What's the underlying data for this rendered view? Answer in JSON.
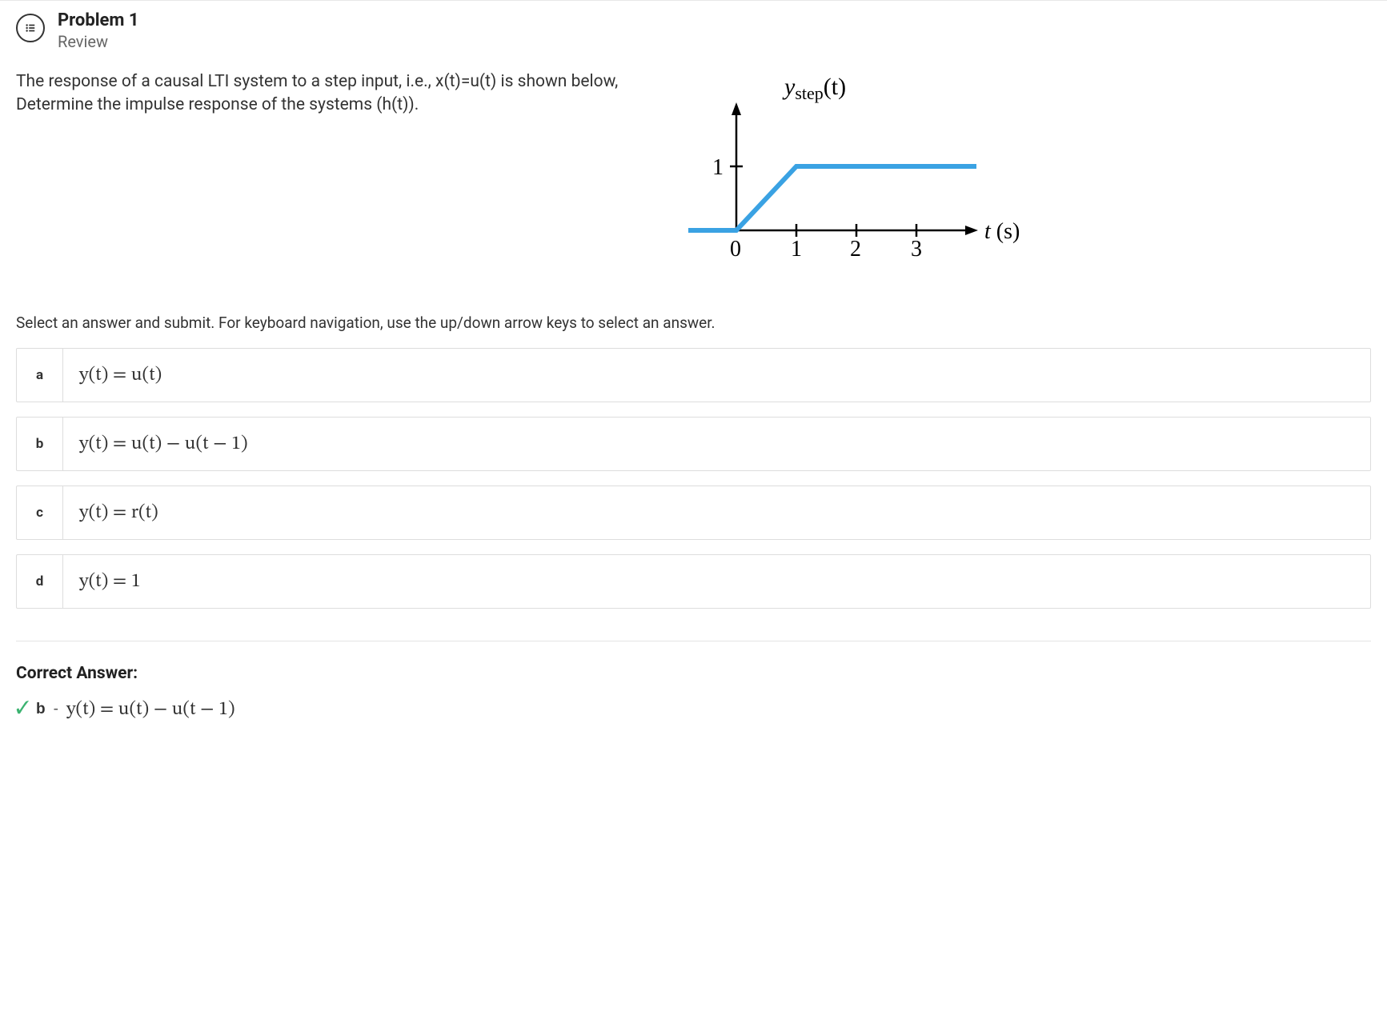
{
  "header": {
    "title": "Problem 1",
    "subtitle": "Review"
  },
  "question": {
    "line1": "The response of a causal LTI system to a step input, i.e., x(t)=u(t) is shown below,",
    "line2": "Determine the impulse response of the systems (h(t))."
  },
  "graph": {
    "y_label": "y",
    "y_label_sub": "step",
    "y_label_arg": "(t)",
    "x_label": "t (s)",
    "y_tick": "1",
    "x_ticks": [
      "0",
      "1",
      "2",
      "3"
    ]
  },
  "instruction": "Select an answer and submit. For keyboard navigation, use the up/down arrow keys to select an answer.",
  "options": [
    {
      "letter": "a",
      "text": "y(t) = u(t)"
    },
    {
      "letter": "b",
      "text": "y(t) = u(t) − u(t − 1)"
    },
    {
      "letter": "c",
      "text": "y(t) = r(t)"
    },
    {
      "letter": "d",
      "text": "y(t) = 1"
    }
  ],
  "correct": {
    "label": "Correct Answer:",
    "letter": "b",
    "text": "y(t) = u(t) − u(t − 1)"
  },
  "chart_data": {
    "type": "line",
    "title": "y_step(t)",
    "xlabel": "t (s)",
    "ylabel": "y_step(t)",
    "xlim": [
      -1,
      4
    ],
    "ylim": [
      0,
      1
    ],
    "x_ticks": [
      0,
      1,
      2,
      3
    ],
    "y_ticks": [
      1
    ],
    "series": [
      {
        "name": "y_step",
        "points": [
          {
            "t": -1,
            "y": 0
          },
          {
            "t": 0,
            "y": 0
          },
          {
            "t": 1,
            "y": 1
          },
          {
            "t": 4,
            "y": 1
          }
        ]
      }
    ]
  }
}
